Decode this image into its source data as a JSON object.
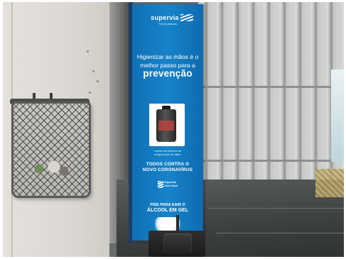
{
  "sign": {
    "brand_name": "supervia",
    "brand_tagline": "Trens urbanos",
    "headline_line1": "Higienizar as mãos é o",
    "headline_line2": "melhor passo para a",
    "headline_strong": "prevenção",
    "product_caption_line1": "Lembre-se também de",
    "product_caption_line2": "sempre lavar as mãos.",
    "campaign_line1": "TODOS CONTRA O",
    "campaign_line2": "NOVO CORONAVÍRUS",
    "partner_logo_line1": "Supervia",
    "partner_logo_line2": "Com Você",
    "instruction_line1": "PISE PARA SAIR O",
    "instruction_line2": "ÁLCOOL EM GEL"
  },
  "colors": {
    "panel_blue": "#1783c9",
    "panel_text": "#ffffff",
    "wall": "#dcd9d4",
    "shutter": "#c9cbca",
    "floor": "#3f4243"
  },
  "icons": [
    "supervia-logo-icon",
    "sanitizer-bottle-icon",
    "partner-logo-icon",
    "foot-pedal-icon"
  ]
}
